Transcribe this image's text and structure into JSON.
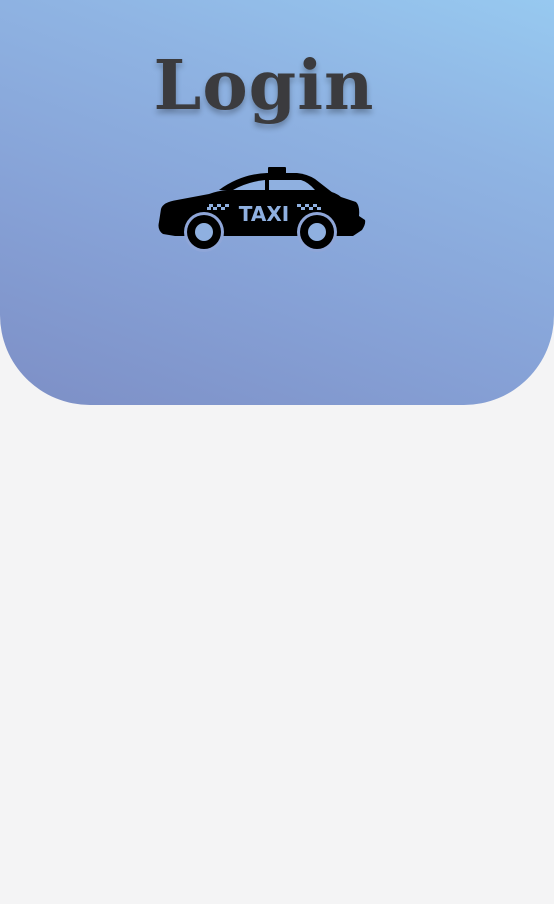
{
  "header": {
    "title": "Login",
    "logo": {
      "icon": "taxi-car-icon",
      "text": "TAXI"
    }
  },
  "colors": {
    "background": "#f4f4f5",
    "header_gradient_start": "#97c9f0",
    "header_gradient_end": "#7d8fc6",
    "title_text": "#3b3b3e",
    "logo": "#000000",
    "logo_accent": "#8fb0e0"
  }
}
